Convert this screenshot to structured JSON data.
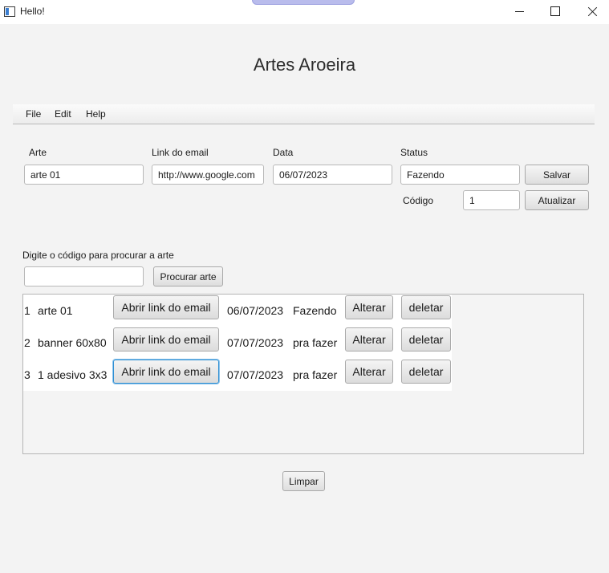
{
  "window": {
    "title": "Hello!"
  },
  "header": {
    "title": "Artes Aroeira"
  },
  "menu": {
    "items": [
      "File",
      "Edit",
      "Help"
    ]
  },
  "form": {
    "arte_label": "Arte",
    "arte_value": "arte 01",
    "link_label": "Link do email",
    "link_value": "http://www.google.com",
    "data_label": "Data",
    "data_value": "06/07/2023",
    "status_label": "Status",
    "status_value": "Fazendo",
    "save_label": "Salvar",
    "codigo_label": "Código",
    "codigo_value": "1",
    "update_label": "Atualizar"
  },
  "search": {
    "label": "Digite o código para procurar a arte",
    "value": "",
    "button_label": "Procurar arte"
  },
  "list": {
    "rows": [
      {
        "id": "1",
        "name": "arte 01",
        "open_label": "Abrir link do email",
        "date": "06/07/2023",
        "status": "Fazendo",
        "edit_label": "Alterar",
        "delete_label": "deletar"
      },
      {
        "id": "2",
        "name": "banner 60x80",
        "open_label": "Abrir link do email",
        "date": "07/07/2023",
        "status": "pra fazer",
        "edit_label": "Alterar",
        "delete_label": "deletar"
      },
      {
        "id": "3",
        "name": "1 adesivo 3x3",
        "open_label": "Abrir link do email",
        "date": "07/07/2023",
        "status": "pra fazer",
        "edit_label": "Alterar",
        "delete_label": "deletar"
      }
    ]
  },
  "footer": {
    "clear_label": "Limpar"
  }
}
